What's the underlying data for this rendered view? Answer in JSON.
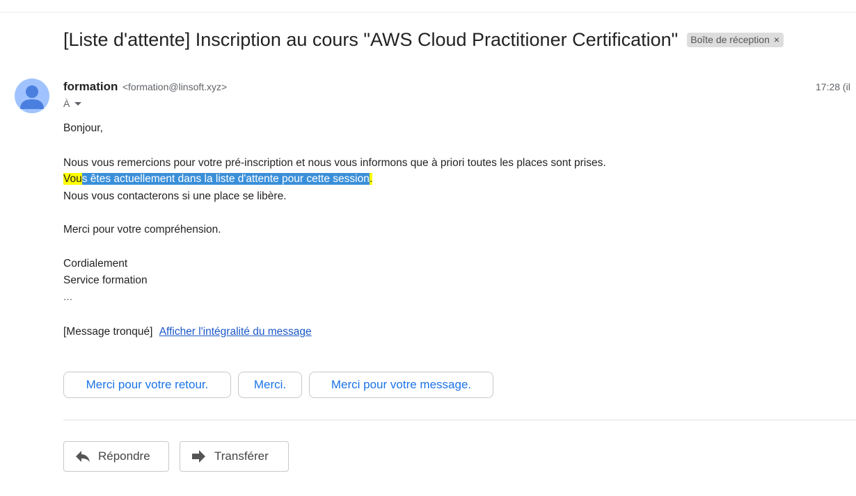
{
  "email": {
    "subject": "[Liste d'attente] Inscription au cours \"AWS Cloud Practitioner Certification\"",
    "label": "Boîte de réception",
    "label_remove": "×",
    "sender_name": "formation",
    "sender_email": "<formation@linsoft.xyz>",
    "time": "17:28 (il",
    "recipient_label": "À",
    "body": {
      "greeting": "Bonjour,",
      "line1": "Nous vous remercions pour votre pré-inscription et nous vous informons que à priori toutes les places sont prises.",
      "line2_yellow_start": "Vou",
      "line2_selected": "s êtes actuellement dans la liste d'attente pour cette session",
      "line2_yellow_end": ".",
      "line3": "Nous vous contacterons si une place se libère.",
      "thanks": "Merci pour votre compréhension.",
      "closing": "Cordialement",
      "signature": "Service formation",
      "ellipsis": "..."
    },
    "truncated_text": "[Message tronqué]",
    "show_full_link": "Afficher l'intégralité du message"
  },
  "smart_replies": [
    "Merci pour votre retour.",
    "Merci.",
    "Merci pour votre message."
  ],
  "actions": {
    "reply": "Répondre",
    "forward": "Transférer"
  },
  "colors": {
    "accent": "#1a73e8",
    "avatar": "#a0c3ff",
    "highlight": "#ffff00",
    "selection": "#3a8fd9"
  }
}
